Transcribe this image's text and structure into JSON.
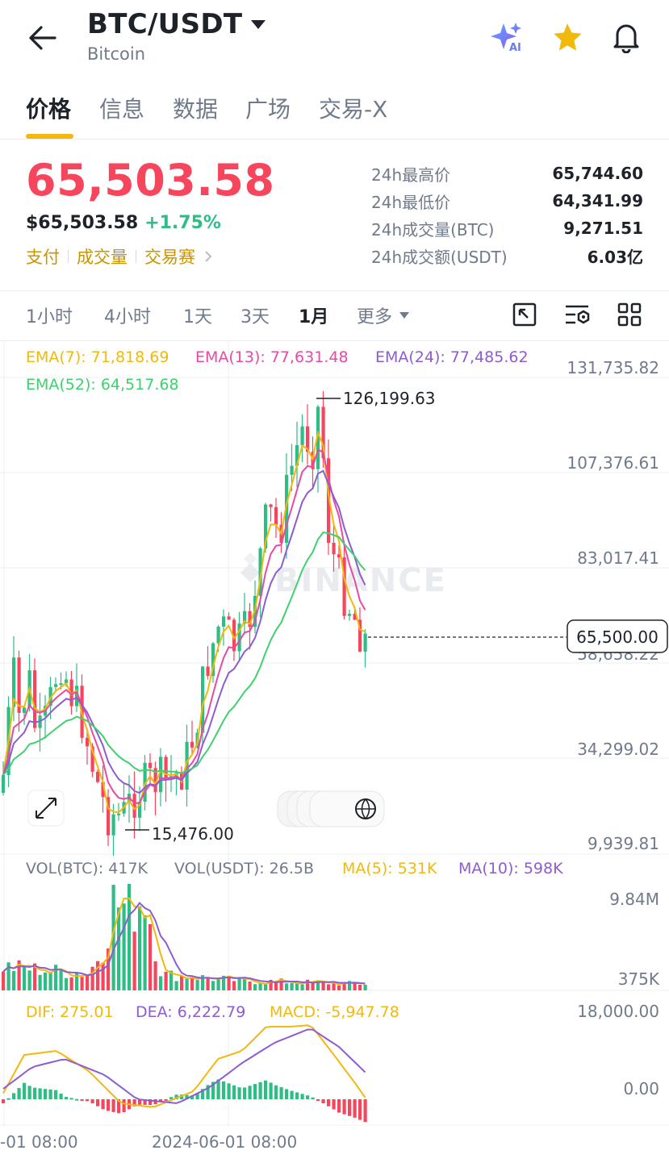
{
  "header": {
    "pair": "BTC/USDT",
    "name": "Bitcoin"
  },
  "tabs": [
    "价格",
    "信息",
    "数据",
    "广场",
    "交易-X"
  ],
  "ticker": {
    "price": "65,503.58",
    "fiat": "$65,503.58",
    "change": "+1.75%",
    "tags": [
      "支付",
      "成交量",
      "交易赛"
    ]
  },
  "stats": [
    {
      "label": "24h最高价",
      "value": "65,744.60"
    },
    {
      "label": "24h最低价",
      "value": "64,341.99"
    },
    {
      "label": "24h成交量(BTC)",
      "value": "9,271.51"
    },
    {
      "label": "24h成交额(USDT)",
      "value": "6.03亿"
    }
  ],
  "timeframes": [
    "1小时",
    "4小时",
    "1天",
    "3天",
    "1月",
    "更多"
  ],
  "active_timeframe": "1月",
  "main_chart": {
    "ema_legend": [
      "EMA(7): 71,818.69",
      "EMA(13): 77,631.48",
      "EMA(24): 77,485.62",
      "EMA(52): 64,517.68"
    ],
    "axis_labels": [
      "131,735.82",
      "107,376.61",
      "83,017.41",
      "58,658.22",
      "34,299.02",
      "9,939.81"
    ],
    "high_label": "126,199.63",
    "low_label": "15,476.00",
    "last_price": "65,500.00",
    "watermark": "BINANCE"
  },
  "volume_chart": {
    "legend": [
      "VOL(BTC): 417K",
      "VOL(USDT): 26.5B",
      "MA(5): 531K",
      "MA(10): 598K"
    ],
    "axis_labels": [
      "9.84M",
      "375K"
    ]
  },
  "macd_chart": {
    "legend": [
      "DIF: 275.01",
      "DEA: 6,222.79",
      "MACD: -5,947.78"
    ],
    "axis_labels": [
      "18,000.00",
      "0.00"
    ]
  },
  "time_axis": [
    "-01 08:00",
    "2024-06-01 08:00"
  ],
  "colors": {
    "up": "#2ebd85",
    "down": "#f6465d",
    "accent": "#f0b90b",
    "ema7": "#f0b90b",
    "ema13": "#e84aa3",
    "ema24": "#8d5dd0",
    "ema52": "#3ed16f"
  }
}
